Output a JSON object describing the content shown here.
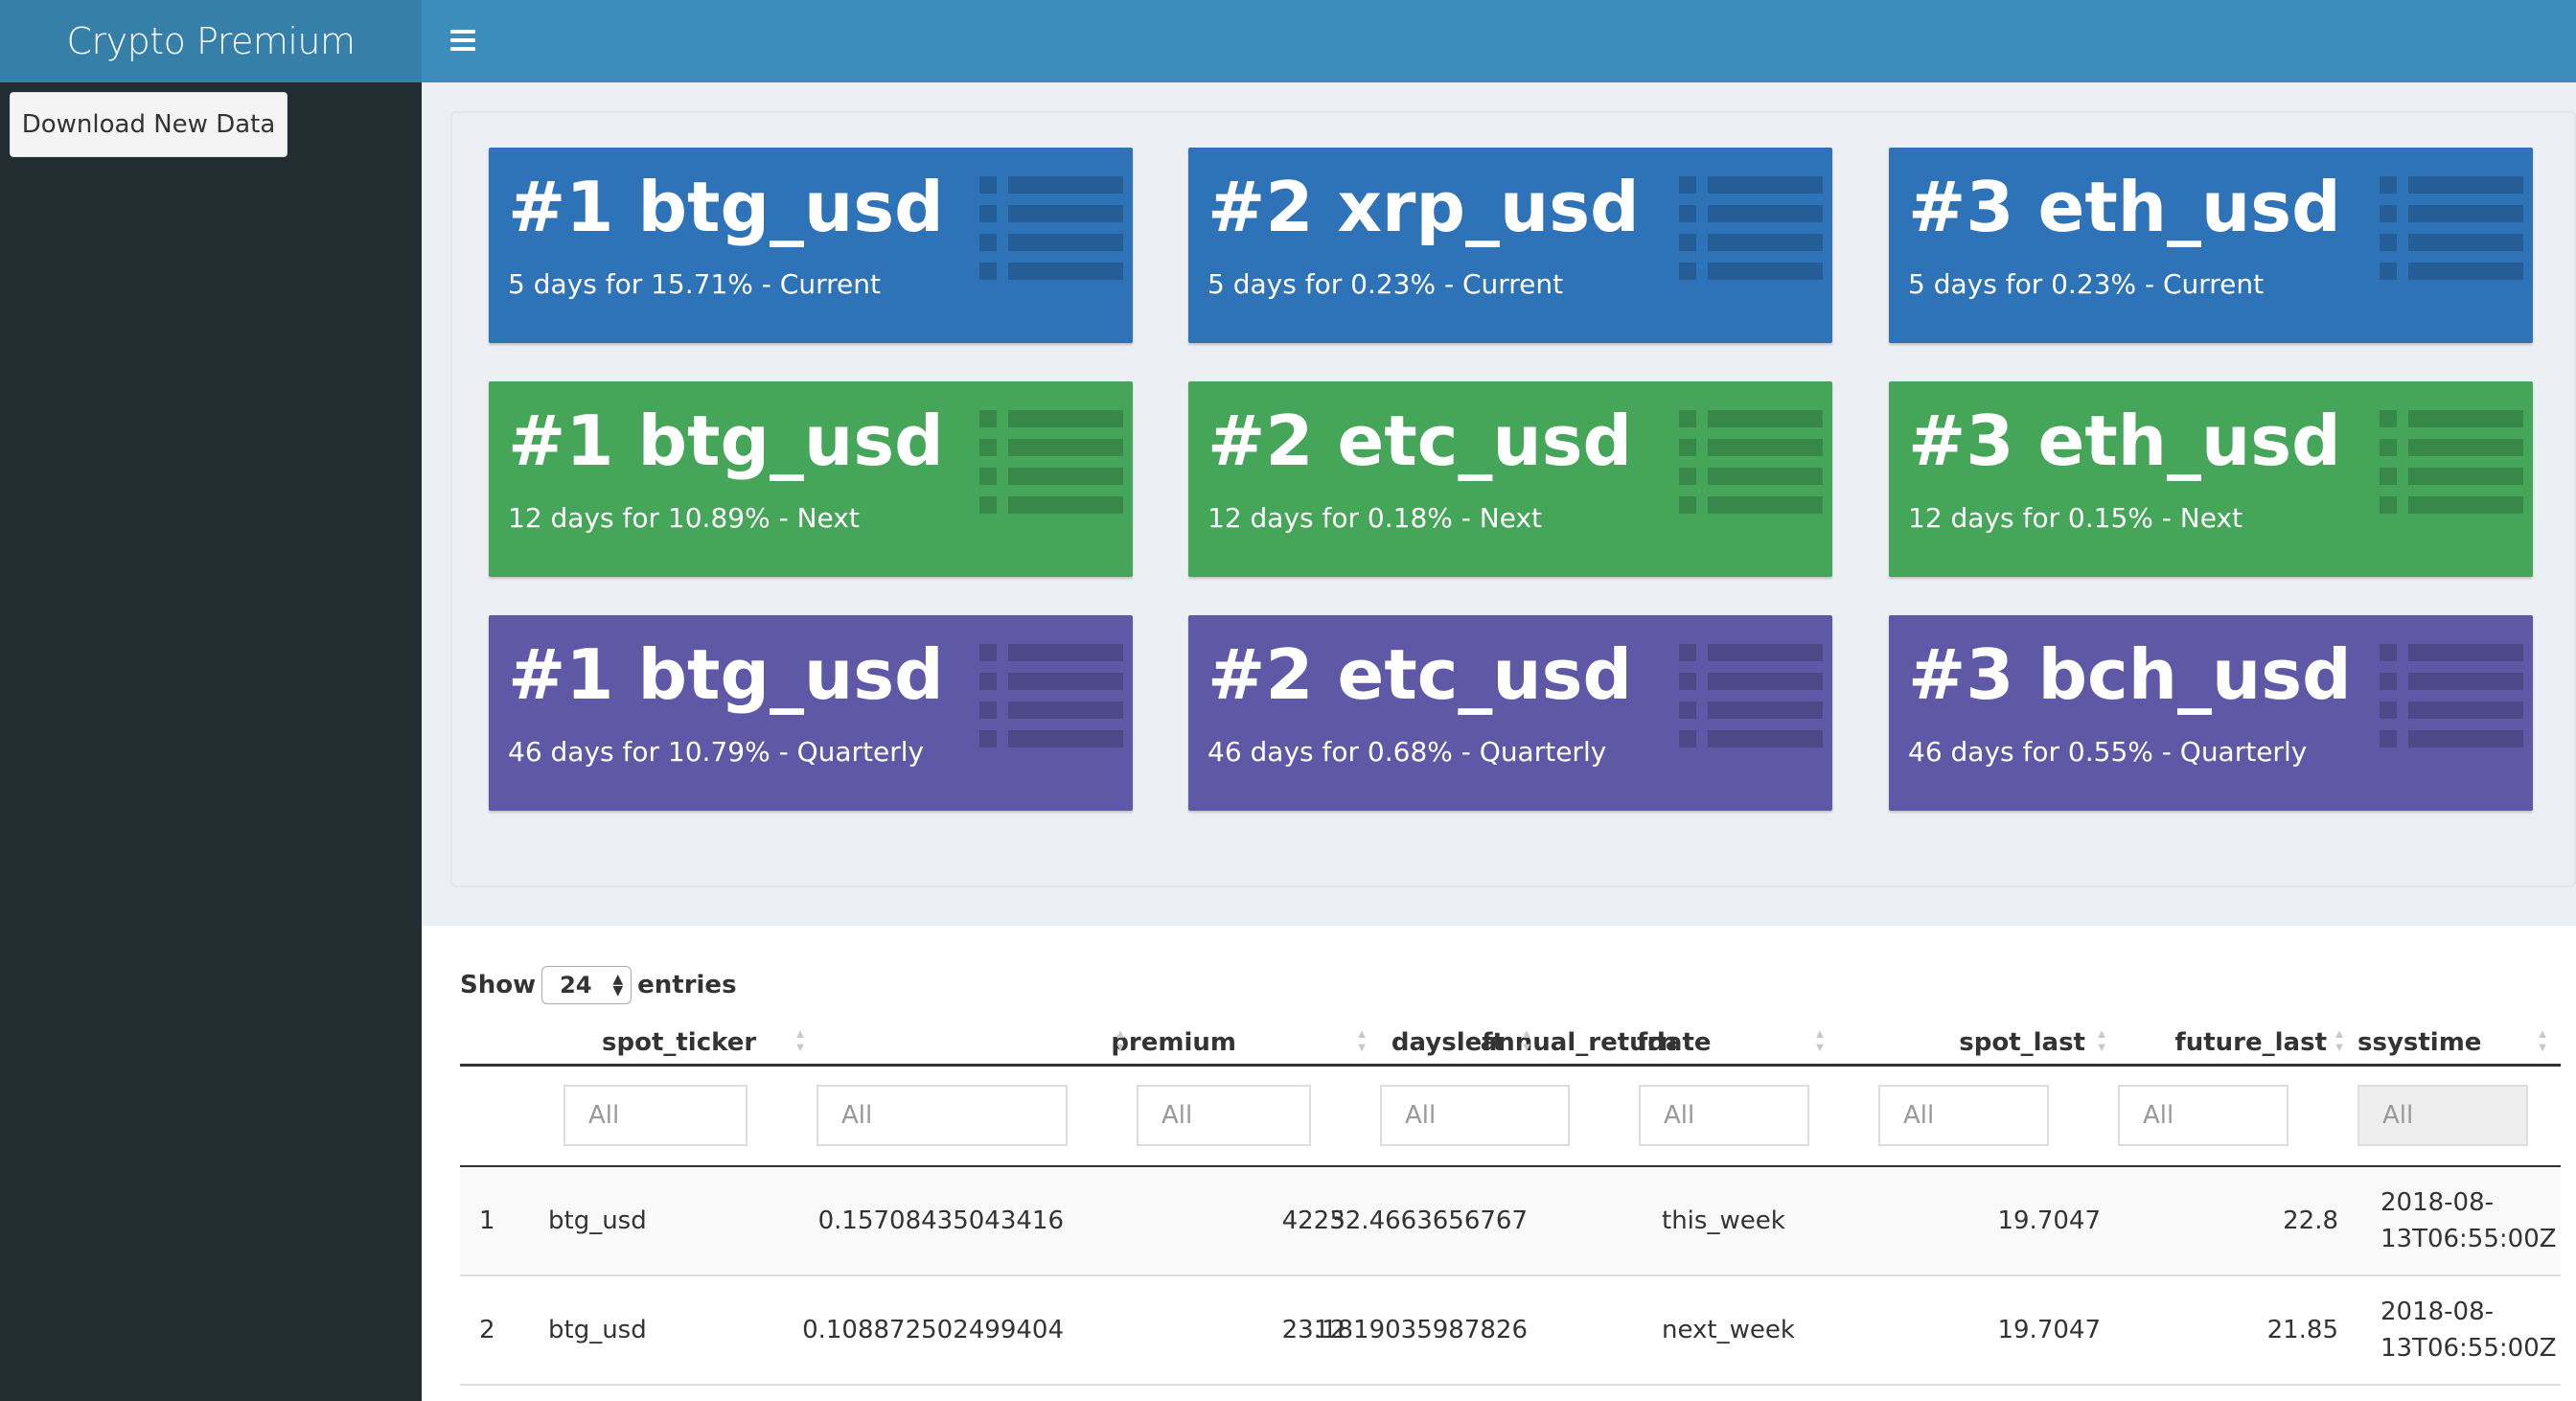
{
  "app": {
    "title": "Crypto Premium"
  },
  "sidebar": {
    "download_label": "Download New Data"
  },
  "tiles": [
    {
      "title": "#1 btg_usd",
      "subtitle": "5 days for 15.71% - Current",
      "color": "#2e73b8"
    },
    {
      "title": "#2 xrp_usd",
      "subtitle": "5 days for 0.23% - Current",
      "color": "#2e73b8"
    },
    {
      "title": "#3 eth_usd",
      "subtitle": "5 days for 0.23% - Current",
      "color": "#2e73b8"
    },
    {
      "title": "#1 btg_usd",
      "subtitle": "12 days for 10.89% - Next",
      "color": "#45a659"
    },
    {
      "title": "#2 etc_usd",
      "subtitle": "12 days for 0.18% - Next",
      "color": "#45a659"
    },
    {
      "title": "#3 eth_usd",
      "subtitle": "12 days for 0.15% - Next",
      "color": "#45a659"
    },
    {
      "title": "#1 btg_usd",
      "subtitle": "46 days for 10.79% - Quarterly",
      "color": "#5e58a6"
    },
    {
      "title": "#2 etc_usd",
      "subtitle": "46 days for 0.68% - Quarterly",
      "color": "#5e58a6"
    },
    {
      "title": "#3 bch_usd",
      "subtitle": "46 days for 0.55% - Quarterly",
      "color": "#5e58a6"
    }
  ],
  "table": {
    "show_label": "Show",
    "entries_label": "entries",
    "page_length": "24",
    "columns": [
      "spot_ticker",
      "premium",
      "daysleft",
      "annual_return",
      "fdate",
      "spot_last",
      "future_last",
      "ssystime"
    ],
    "filter_placeholder": "All",
    "rows": [
      [
        "1",
        "btg_usd",
        "0.15708435043416",
        "5",
        "42232.4663656767",
        "this_week",
        "19.7047",
        "22.8",
        "2018-08-",
        "13T06:55:00Z"
      ],
      [
        "2",
        "btg_usd",
        "0.108872502499404",
        "12",
        "23.1819035987826",
        "next_week",
        "19.7047",
        "21.85",
        "2018-08-",
        "13T06:55:00Z"
      ]
    ]
  }
}
